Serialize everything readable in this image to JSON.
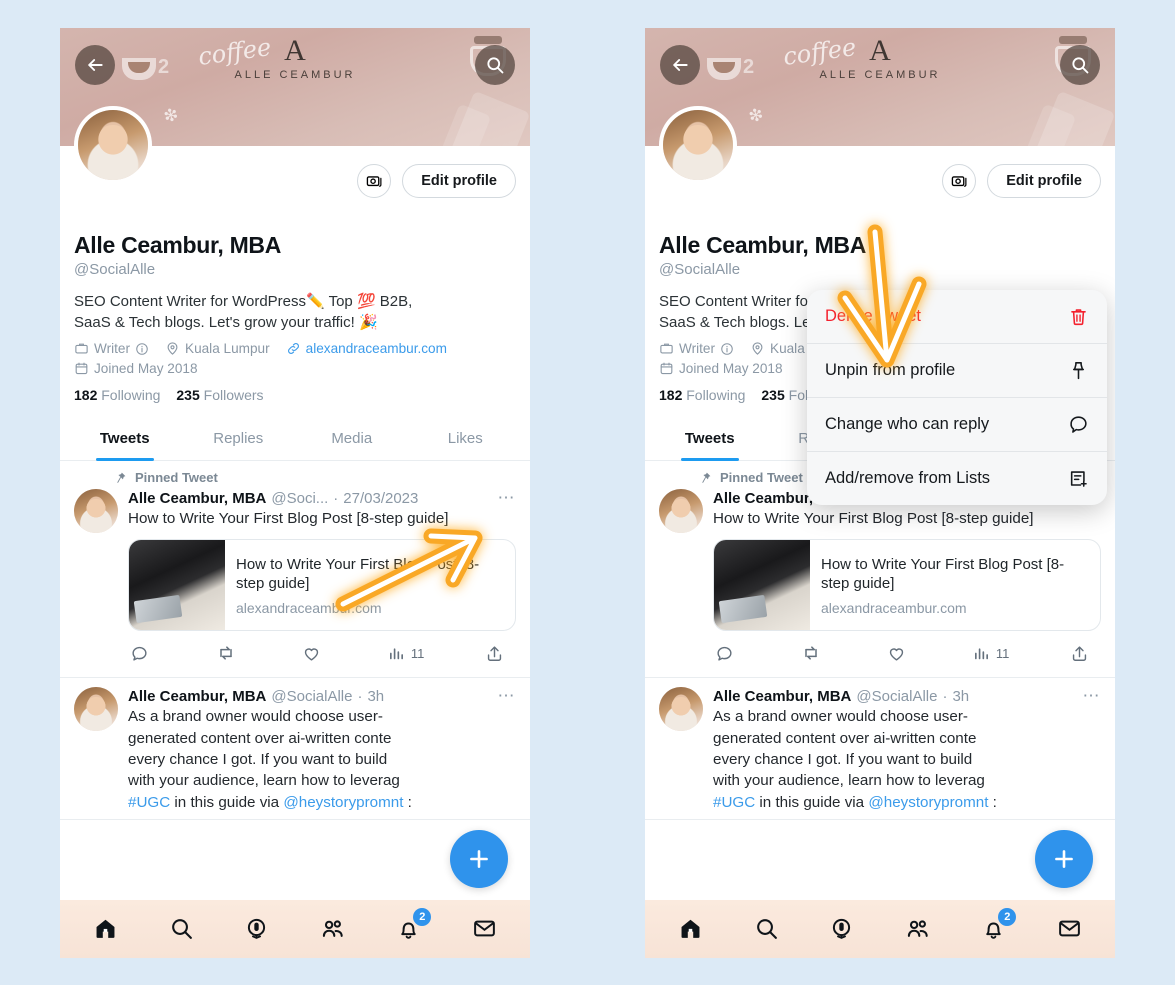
{
  "background_color": "#dceaf6",
  "accent_color": "#1d9bf0",
  "danger_color": "#f4212e",
  "highlight_arrow_color": "#f9a826",
  "banner": {
    "brand_logo": "A",
    "brand_name": "ALLE CEAMBUR",
    "brand_script": "coffee",
    "sparkle": "❇",
    "cup_count": "2",
    "back_icon": "back-arrow-icon",
    "search_icon": "search-icon"
  },
  "profile": {
    "camera_icon": "camera-photos-icon",
    "edit_profile_label": "Edit profile",
    "display_name": "Alle Ceambur, MBA",
    "handle": "@SocialAlle",
    "bio_line1": "SEO Content Writer for WordPress✏️ Top 💯 B2B,",
    "bio_line2": "SaaS & Tech blogs. Let's grow your traffic! 🎉",
    "occupation": "Writer",
    "location": "Kuala Lumpur",
    "website": "alexandraceambur.com",
    "joined": "Joined May 2018",
    "following_count": "182",
    "following_label": "Following",
    "followers_count": "235",
    "followers_label": "Followers"
  },
  "tabs": [
    {
      "label": "Tweets",
      "active": true
    },
    {
      "label": "Replies",
      "active": false
    },
    {
      "label": "Media",
      "active": false
    },
    {
      "label": "Likes",
      "active": false
    }
  ],
  "pinned_tweet": {
    "pin_label": "Pinned Tweet",
    "pin_icon": "pin-icon",
    "author": "Alle Ceambur, MBA",
    "handle": "@Soci...",
    "separator": "·",
    "date": "27/03/2023",
    "more_icon": "more-options-icon",
    "text": "How to Write Your First Blog Post [8-step guide]",
    "card_title": "How to Write Your First Blog Post [8-step guide]",
    "card_domain": "alexandraceambur.com",
    "actions": {
      "reply_icon": "reply-icon",
      "reply_count": "",
      "retweet_icon": "retweet-icon",
      "retweet_count": "",
      "like_icon": "heart-icon",
      "like_count": "",
      "views_icon": "analytics-bar-icon",
      "views_count": "11",
      "share_icon": "share-upload-icon"
    }
  },
  "second_tweet": {
    "author": "Alle Ceambur, MBA",
    "handle": "@SocialAlle",
    "separator": "·",
    "time": "3h",
    "more_icon": "more-options-icon",
    "text_line1": "As a brand owner would choose user-",
    "text_line2": "generated content over ai-written conte",
    "text_line3": "every chance I got. If you want to build",
    "text_line4": "with your audience, learn how to leverag",
    "text_line5_tag1": "#UGC",
    "text_line5_mid": " in this guide via ",
    "text_line5_tag2": "@heystorypromnt",
    "text_line5_end": " :"
  },
  "compose": {
    "icon": "plus-icon",
    "label": "+"
  },
  "bottom_nav": [
    {
      "name": "home",
      "icon": "home-icon",
      "active": true,
      "badge": ""
    },
    {
      "name": "search",
      "icon": "search-icon",
      "active": false,
      "badge": ""
    },
    {
      "name": "spaces",
      "icon": "microphone-icon",
      "active": false,
      "badge": ""
    },
    {
      "name": "communities",
      "icon": "communities-people-icon",
      "active": false,
      "badge": ""
    },
    {
      "name": "notifications",
      "icon": "bell-icon",
      "active": false,
      "badge": "2"
    },
    {
      "name": "messages",
      "icon": "envelope-icon",
      "active": false,
      "badge": ""
    }
  ],
  "dropdown_menu": {
    "items": [
      {
        "label": "Delete Tweet",
        "icon": "trash-icon",
        "danger": true
      },
      {
        "label": "Unpin from profile",
        "icon": "pin-icon",
        "danger": false
      },
      {
        "label": "Change who can reply",
        "icon": "speech-bubble-icon",
        "danger": false
      },
      {
        "label": "Add/remove from Lists",
        "icon": "list-add-icon",
        "danger": false
      }
    ]
  },
  "annotations": {
    "left_arrow": "arrow-pointing-up-right-to-more-options",
    "right_arrow": "arrow-pointing-down-to-delete-tweet"
  }
}
